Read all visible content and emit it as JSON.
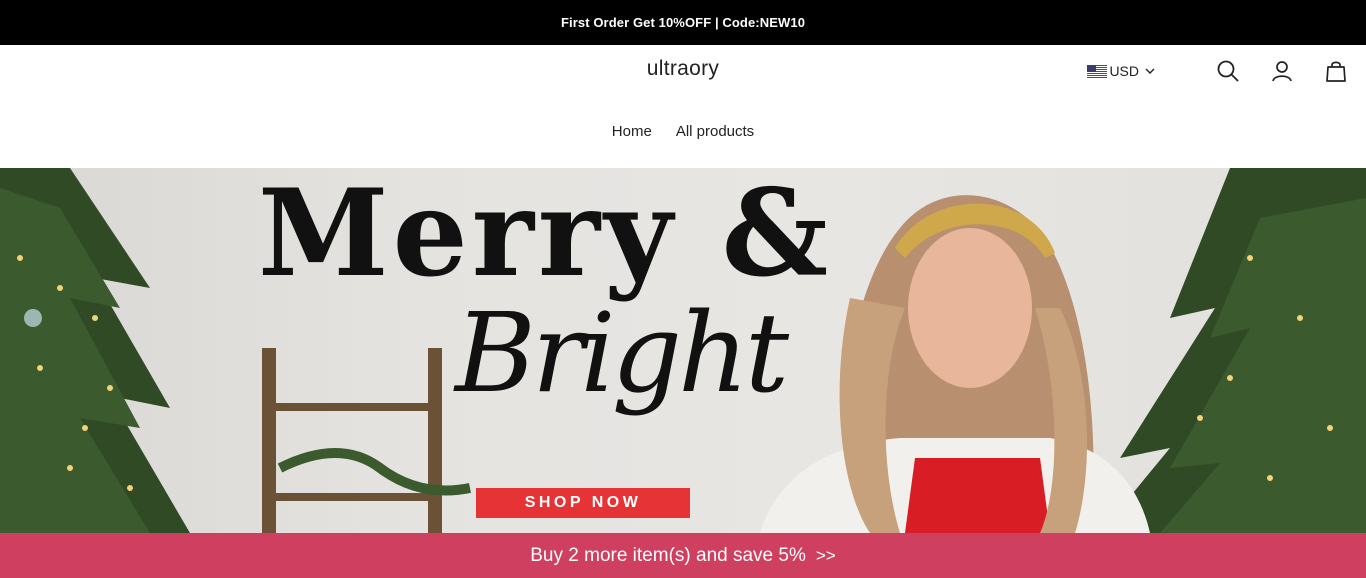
{
  "announcement": {
    "text": "First Order Get 10%OFF | Code:NEW10"
  },
  "header": {
    "logo": "ultraory",
    "currency": {
      "label": "USD",
      "flag": "us-flag-icon"
    },
    "icons": [
      "search-icon",
      "account-icon",
      "cart-icon"
    ]
  },
  "nav": {
    "items": [
      {
        "label": "Home"
      },
      {
        "label": "All products"
      }
    ]
  },
  "hero": {
    "headline": "Merry &",
    "script": "Bright",
    "cta": "SHOP NOW",
    "cta_color": "#e53336"
  },
  "promo_bar": {
    "text": "Buy 2 more item(s) and save 5%",
    "arrow": ">>",
    "color": "#cf3f60"
  }
}
